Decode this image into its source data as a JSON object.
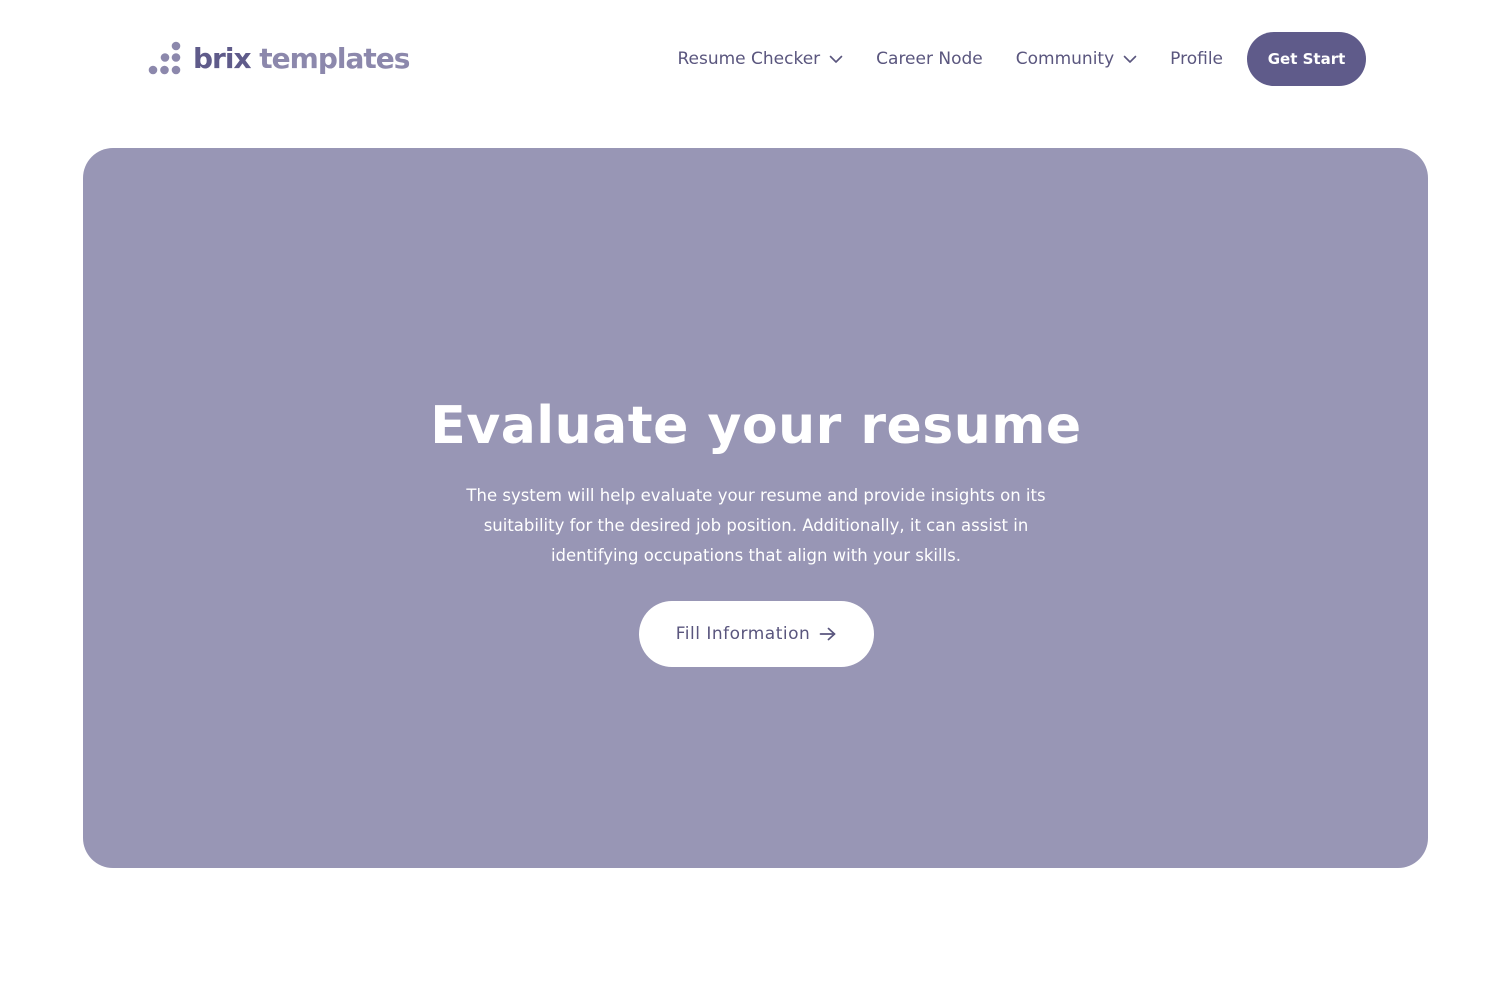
{
  "brand": {
    "name_part1": "brix",
    "name_part2": "templates"
  },
  "nav": {
    "items": [
      {
        "label": "Resume Checker",
        "has_dropdown": true
      },
      {
        "label": "Career Node",
        "has_dropdown": false
      },
      {
        "label": "Community",
        "has_dropdown": true
      },
      {
        "label": "Profile",
        "has_dropdown": false
      }
    ],
    "cta_label": "Get Start"
  },
  "hero": {
    "title": "Evaluate your resume",
    "description": "The system will help evaluate your resume and provide insights on its suitability for the desired job position. Additionally, it can assist in identifying occupations that align with your skills.",
    "button_label": "Fill Information"
  },
  "colors": {
    "brand_primary": "#5f5b8a",
    "brand_secondary": "#8c88ac",
    "hero_background": "#9896b5",
    "text_white": "#ffffff"
  },
  "icons": {
    "logo": "dots-triangle-logo-icon",
    "dropdown": "chevron-down-icon",
    "button_arrow": "arrow-right-icon"
  }
}
